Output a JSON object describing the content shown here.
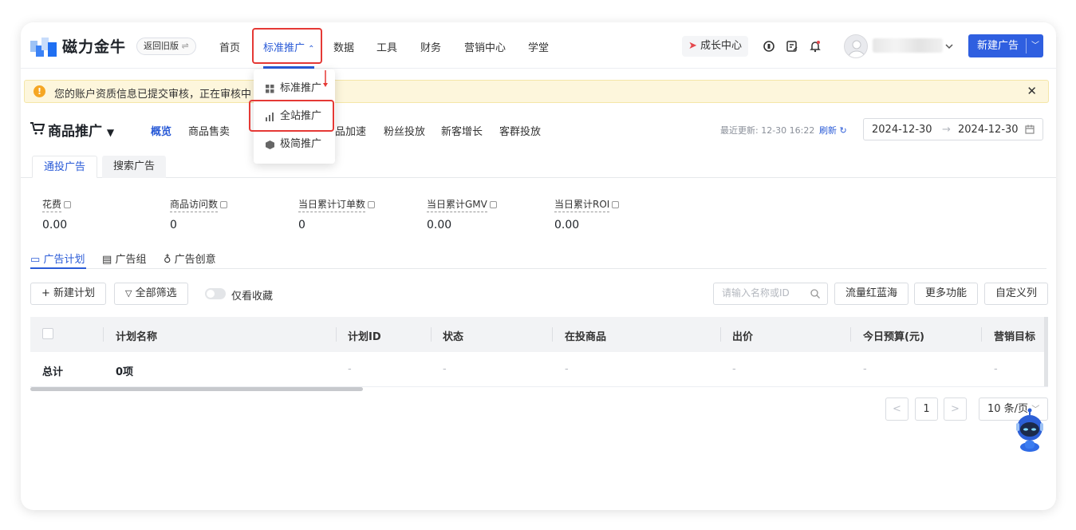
{
  "header": {
    "brand": "磁力金牛",
    "old_version": "返回旧版",
    "nav": [
      "首页",
      "标准推广",
      "数据",
      "工具",
      "财务",
      "营销中心",
      "学堂"
    ],
    "growth_center": "成长中心",
    "new_ad": "新建广告"
  },
  "dropdown": {
    "items": [
      "标准推广",
      "全站推广",
      "极简推广"
    ]
  },
  "notice": {
    "text": "您的账户资质信息已提交审核，正在审核中"
  },
  "page": {
    "title": "商品推广",
    "sub_nav": [
      "概览",
      "商品售卖",
      "品加速",
      "粉丝投放",
      "新客增长",
      "客群投放"
    ],
    "last_updated": "最近更新: 12-30 16:22",
    "refresh": "刷新",
    "date_start": "2024-12-30",
    "date_sep": "→",
    "date_end": "2024-12-30"
  },
  "tabs": [
    "通投广告",
    "搜索广告"
  ],
  "metrics": [
    {
      "label": "花费",
      "value": "0.00"
    },
    {
      "label": "商品访问数",
      "value": "0"
    },
    {
      "label": "当日累计订单数",
      "value": "0"
    },
    {
      "label": "当日累计GMV",
      "value": "0.00"
    },
    {
      "label": "当日累计ROI",
      "value": "0.00"
    }
  ],
  "object_tabs": [
    "广告计划",
    "广告组",
    "广告创意"
  ],
  "toolbar": {
    "new_plan": "+ 新建计划",
    "filter_all": "全部筛选",
    "favorites_only": "仅看收藏",
    "search_placeholder": "请输入名称或ID",
    "traffic": "流量红蓝海",
    "more": "更多功能",
    "custom_columns": "自定义列"
  },
  "table": {
    "columns": [
      "计划名称",
      "计划ID",
      "状态",
      "在投商品",
      "出价",
      "今日预算(元)",
      "营销目标"
    ],
    "total_row": {
      "label": "总计",
      "name": "0项",
      "dash": "-"
    }
  },
  "pagination": {
    "prev": "<",
    "current": "1",
    "next": ">",
    "page_size": "10 条/页"
  },
  "colors": {
    "accent": "#2a5bd7",
    "primary_button": "#2f5fe0",
    "highlight_box": "#e53935",
    "notice_bg": "#fdf6dc"
  }
}
